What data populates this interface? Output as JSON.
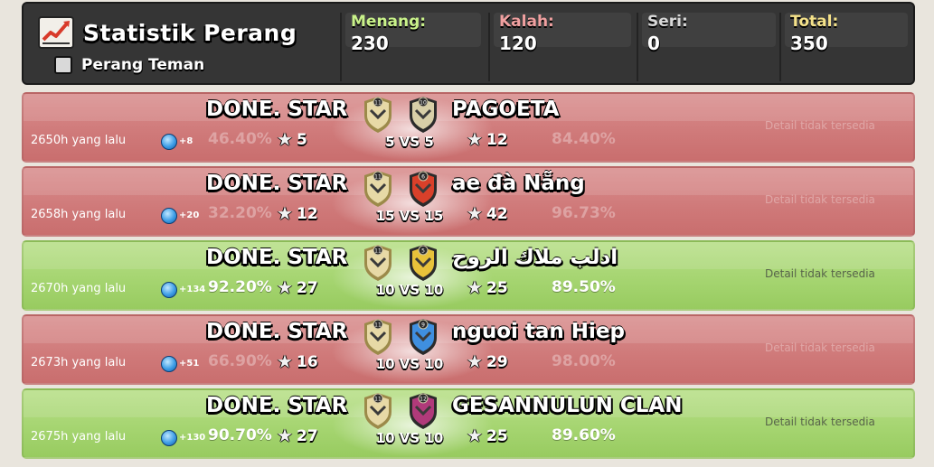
{
  "header": {
    "title": "Statistik Perang",
    "friendly_label": "Perang Teman",
    "stats": [
      {
        "label": "Menang:",
        "value": "230",
        "color": "#c9f28a"
      },
      {
        "label": "Kalah:",
        "value": "120",
        "color": "#f0a0a0"
      },
      {
        "label": "Seri:",
        "value": "0",
        "color": "#d8d8d8"
      },
      {
        "label": "Total:",
        "value": "350",
        "color": "#f5e28a"
      }
    ]
  },
  "wars": [
    {
      "result": "loss",
      "ago": "2650h yang lalu",
      "xp": "+8",
      "own_name": "DONE. STAR",
      "own_pct": "46.40%",
      "own_stars": "5",
      "size": "5 VS 5",
      "opp_name": "PAGOETA",
      "opp_stars": "12",
      "opp_pct": "84.40%",
      "detail": "Detail tidak tersedia",
      "own_badge_level": "11",
      "opp_badge_level": "10",
      "opp_badge_color": "#d8cfa8"
    },
    {
      "result": "loss",
      "ago": "2658h yang lalu",
      "xp": "+20",
      "own_name": "DONE. STAR",
      "own_pct": "32.20%",
      "own_stars": "12",
      "size": "15 VS 15",
      "opp_name": "ae đà Nẵng",
      "opp_stars": "42",
      "opp_pct": "96.73%",
      "detail": "Detail tidak tersedia",
      "own_badge_level": "11",
      "opp_badge_level": "6",
      "opp_badge_color": "#d9402a"
    },
    {
      "result": "win",
      "ago": "2670h yang lalu",
      "xp": "+134",
      "own_name": "DONE. STAR",
      "own_pct": "92.20%",
      "own_stars": "27",
      "size": "10 VS 10",
      "opp_name": "ادلب ملاك الروح",
      "opp_stars": "25",
      "opp_pct": "89.50%",
      "detail": "Detail tidak tersedia",
      "own_badge_level": "11",
      "opp_badge_level": "5",
      "opp_badge_color": "#e8c23a"
    },
    {
      "result": "loss",
      "ago": "2673h yang lalu",
      "xp": "+51",
      "own_name": "DONE. STAR",
      "own_pct": "66.90%",
      "own_stars": "16",
      "size": "10 VS 10",
      "opp_name": "nguoi tan Hiep",
      "opp_stars": "29",
      "opp_pct": "98.00%",
      "detail": "Detail tidak tersedia",
      "own_badge_level": "11",
      "opp_badge_level": "9",
      "opp_badge_color": "#3f8fe0"
    },
    {
      "result": "win",
      "ago": "2675h yang lalu",
      "xp": "+130",
      "own_name": "DONE. STAR",
      "own_pct": "90.70%",
      "own_stars": "27",
      "size": "10 VS 10",
      "opp_name": "GESANNULUN CLAN",
      "opp_stars": "25",
      "opp_pct": "89.60%",
      "detail": "Detail tidak tersedia",
      "own_badge_level": "11",
      "opp_badge_level": "12",
      "opp_badge_color": "#b03a7a"
    }
  ]
}
